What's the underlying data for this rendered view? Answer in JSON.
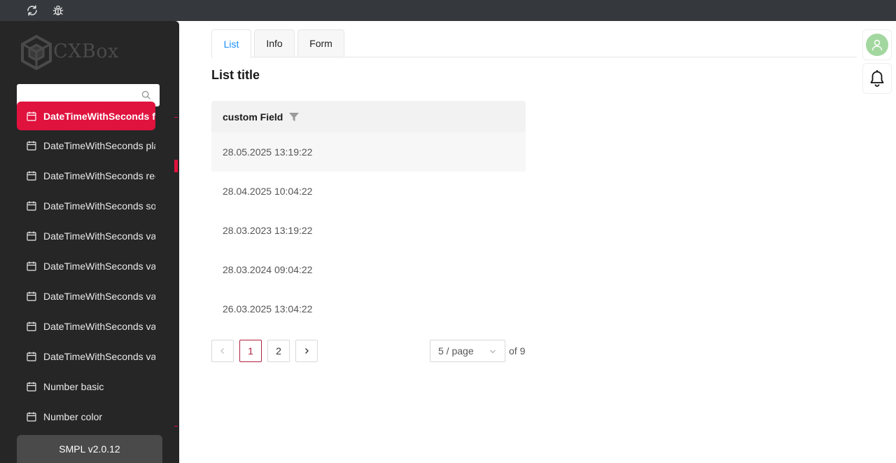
{
  "topbar": {
    "icons": [
      "refresh-icon",
      "bug-icon"
    ]
  },
  "sidebar": {
    "logo_text": "CXBox",
    "search": {
      "placeholder": "",
      "value": ""
    },
    "items": [
      {
        "label": "DateTimeWithSeconds fil",
        "active": true
      },
      {
        "label": "DateTimeWithSeconds pla"
      },
      {
        "label": "DateTimeWithSeconds rec"
      },
      {
        "label": "DateTimeWithSeconds so"
      },
      {
        "label": "DateTimeWithSeconds va"
      },
      {
        "label": "DateTimeWithSeconds va"
      },
      {
        "label": "DateTimeWithSeconds va"
      },
      {
        "label": "DateTimeWithSeconds va"
      },
      {
        "label": "DateTimeWithSeconds va"
      },
      {
        "label": "Number basic"
      },
      {
        "label": "Number color"
      }
    ],
    "version": "SMPL v2.0.12",
    "accent_color": "#e0123e"
  },
  "tabs": [
    {
      "label": "List",
      "active": true
    },
    {
      "label": "Info"
    },
    {
      "label": "Form"
    }
  ],
  "main": {
    "title": "List title",
    "table": {
      "column": "custom Field",
      "rows": [
        "28.05.2025 13:19:22",
        "28.04.2025 10:04:22",
        "28.03.2023 13:19:22",
        "28.03.2024 09:04:22",
        "26.03.2025 13:04:22"
      ]
    },
    "pagination": {
      "prev": "<",
      "next": ">",
      "pages": [
        "1",
        "2"
      ],
      "current": "1",
      "page_size": "5 / page",
      "total_label": "of 9"
    }
  }
}
